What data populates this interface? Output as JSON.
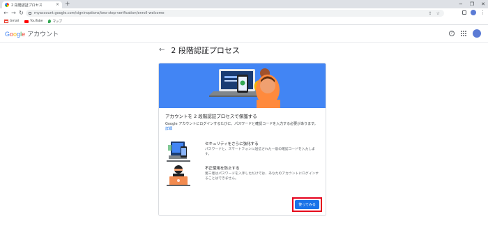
{
  "browser": {
    "tab_title": "2 段階認証プロセス",
    "tab_close": "×",
    "new_tab": "+",
    "window_controls": [
      "−",
      "❐",
      "✕"
    ],
    "url": "myaccount.google.com/signinoptions/two-step-verification/enroll-welcome",
    "nav": {
      "back": "←",
      "forward": "→",
      "reload": "↻"
    },
    "bookmarks": [
      {
        "label": "Gmail",
        "icon": "gmail-icon"
      },
      {
        "label": "YouTube",
        "icon": "youtube-icon"
      },
      {
        "label": "マップ",
        "icon": "maps-icon"
      }
    ]
  },
  "header": {
    "logo_letters": [
      {
        "ch": "G",
        "color": "#4285f4"
      },
      {
        "ch": "o",
        "color": "#ea4335"
      },
      {
        "ch": "o",
        "color": "#fbbc05"
      },
      {
        "ch": "g",
        "color": "#4285f4"
      },
      {
        "ch": "l",
        "color": "#34a853"
      },
      {
        "ch": "e",
        "color": "#ea4335"
      }
    ],
    "product": "アカウント",
    "help": "?"
  },
  "page": {
    "back": "←",
    "title": "2 段階認証プロセス"
  },
  "card": {
    "heading": "アカウントを 2 段階認証プロセスで保護する",
    "description": "Google アカウントにログインするたびに、パスワードと確認コードを入力する必要があります。",
    "details_link": "詳細",
    "features": [
      {
        "title": "セキュリティをさらに強化する",
        "text": "パスワードと、スマートフォンに送信された一意の確認コードを入力します。"
      },
      {
        "title": "不正使用を防止する",
        "text": "第三者はパスワードを入手しただけでは、あなたのアカウントにログインすることはできません。"
      }
    ],
    "cta_label": "使ってみる"
  },
  "colors": {
    "hero_blue": "#4285f4",
    "cta_blue": "#1a73e8",
    "highlight_red": "#e5001b"
  }
}
